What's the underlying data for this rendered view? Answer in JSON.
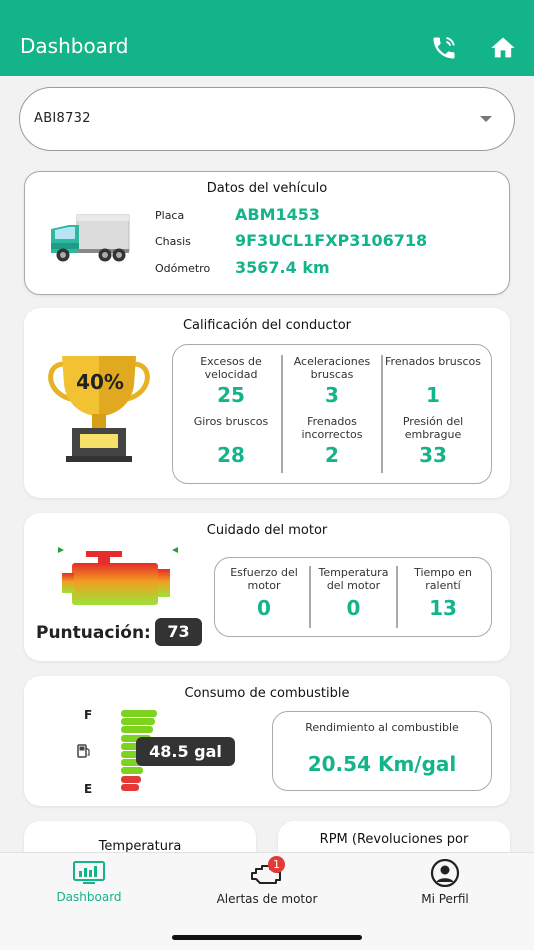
{
  "header": {
    "title": "Dashboard",
    "phone_icon": "phone-icon",
    "home_icon": "home-icon"
  },
  "vehicle_select": {
    "value": "ABI8732"
  },
  "vehicle_data": {
    "title": "Datos del vehículo",
    "rows": [
      {
        "label": "Placa",
        "value": "ABM1453"
      },
      {
        "label": "Chasis",
        "value": "9F3UCL1FXP3106718"
      },
      {
        "label": "Odómetro",
        "value": "3567.4 km"
      }
    ]
  },
  "driver_rating": {
    "title": "Calificación del conductor",
    "percent": "40%",
    "stats": [
      {
        "label": "Excesos de velocidad",
        "value": "25"
      },
      {
        "label": "Aceleraciones bruscas",
        "value": "3"
      },
      {
        "label": "Frenados bruscos",
        "value": "1"
      },
      {
        "label": "Giros bruscos",
        "value": "28"
      },
      {
        "label": "Frenados incorrectos",
        "value": "2"
      },
      {
        "label": "Presión del embrague",
        "value": "33"
      }
    ]
  },
  "engine_care": {
    "title": "Cuidado del motor",
    "score_label": "Puntuación:",
    "score": "73",
    "stats": [
      {
        "label": "Esfuerzo del motor",
        "value": "0"
      },
      {
        "label": "Temperatura del motor",
        "value": "0"
      },
      {
        "label": "Tiempo en ralentí",
        "value": "13"
      }
    ]
  },
  "fuel": {
    "title": "Consumo de combustible",
    "full_label": "F",
    "empty_label": "E",
    "level": "48.5 gal",
    "efficiency_label": "Rendimiento al combustible",
    "efficiency_value": "20.54 Km/gal"
  },
  "partial_cards": {
    "temperature_title": "Temperatura",
    "rpm_title": "RPM (Revoluciones por"
  },
  "bottom_nav": {
    "items": [
      {
        "label": "Dashboard",
        "icon": "dashboard-monitor-icon"
      },
      {
        "label": "Alertas de motor",
        "icon": "engine-alert-icon",
        "badge": "1"
      },
      {
        "label": "Mi Perfil",
        "icon": "profile-icon"
      }
    ]
  },
  "colors": {
    "primary": "#14b48a",
    "badge_red": "#e53935",
    "dark": "#333333"
  }
}
